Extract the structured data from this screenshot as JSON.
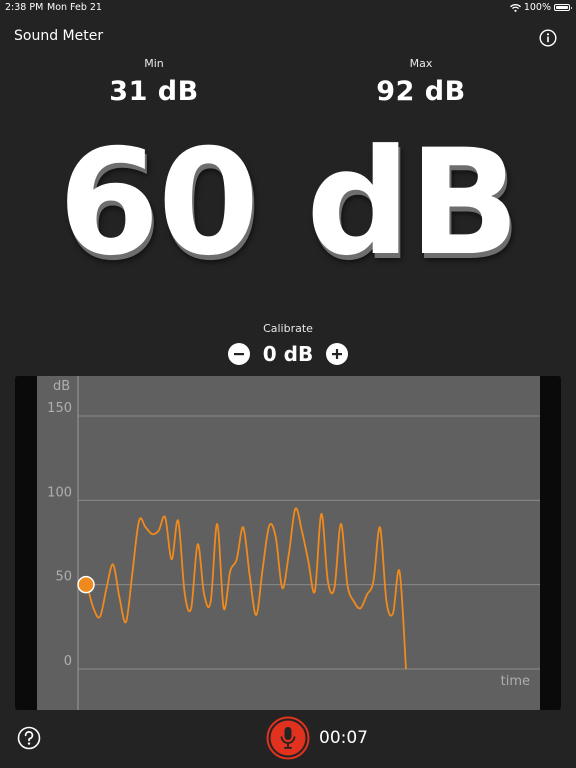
{
  "status_bar": {
    "time": "2:38 PM",
    "date": "Mon Feb 21",
    "battery": "100%",
    "battery_level": 1.0
  },
  "header": {
    "title": "Sound Meter",
    "info_icon": "info-icon"
  },
  "min": {
    "label": "Min",
    "value": "31 dB"
  },
  "max": {
    "label": "Max",
    "value": "92 dB"
  },
  "current_reading": "60 dB",
  "calibrate": {
    "label": "Calibrate",
    "value": "0 dB",
    "minus_icon": "minus-icon",
    "plus_icon": "plus-icon"
  },
  "footer": {
    "help_icon": "help-icon",
    "record_icon": "microphone-icon",
    "record_color": "#e0321e",
    "timer": "00:07"
  },
  "chart_data": {
    "type": "line",
    "ylabel": "dB",
    "xlabel": "time",
    "ylim": [
      0,
      150
    ],
    "yticks": [
      "0",
      "50",
      "100",
      "150"
    ],
    "grid": true,
    "line_color": "#f08a1c",
    "current_value": 50,
    "series": [
      {
        "values": [
          50,
          36,
          31,
          48,
          62,
          42,
          28,
          58,
          88,
          84,
          80,
          82,
          90,
          65,
          88,
          45,
          36,
          74,
          44,
          40,
          86,
          36,
          58,
          65,
          84,
          55,
          32,
          60,
          85,
          78,
          48,
          68,
          95,
          82,
          64,
          46,
          92,
          52,
          48,
          86,
          50,
          40,
          36,
          44,
          52,
          84,
          40,
          33,
          58,
          0
        ]
      }
    ]
  }
}
